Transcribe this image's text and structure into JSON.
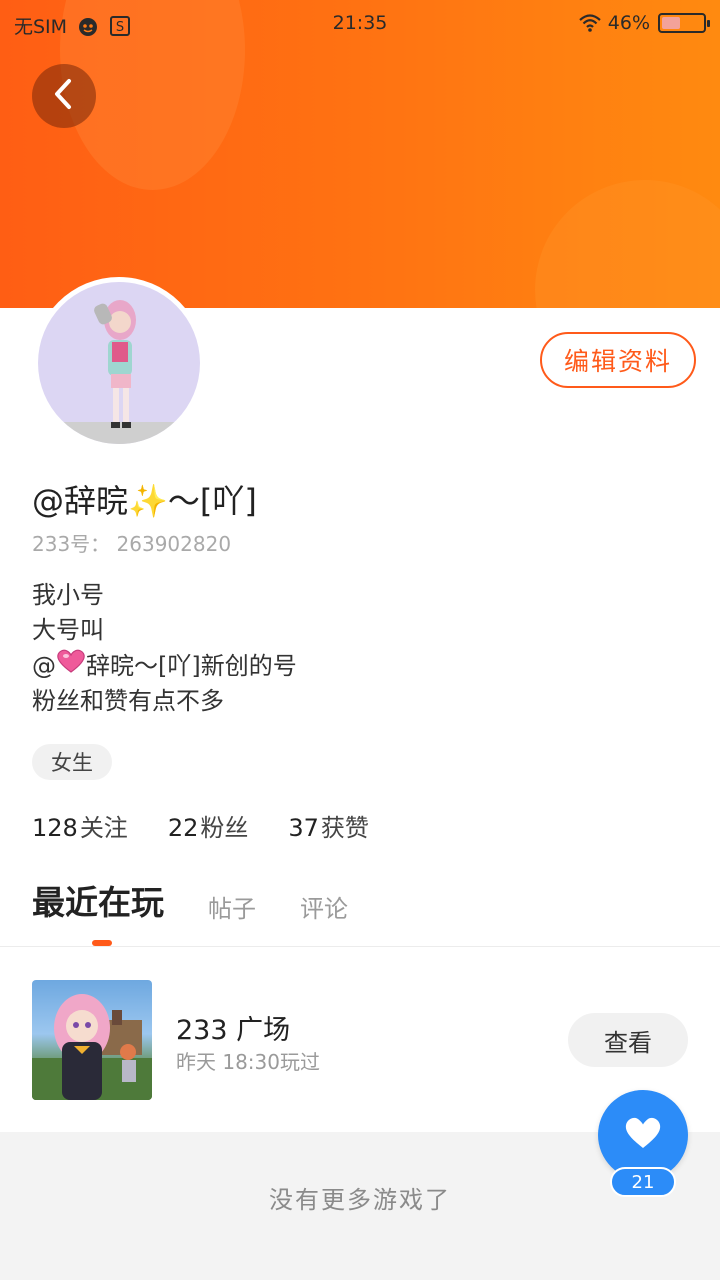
{
  "status_bar": {
    "carrier": "无SIM",
    "time": "21:35",
    "battery": "46%",
    "battery_level": 0.46
  },
  "profile": {
    "username": "@辞晥✨～[吖]",
    "user_id": "233号： 263902820",
    "edit_label": "编辑资料",
    "bio": {
      "line1": "我小号",
      "line2": "大号叫",
      "line3_prefix": "@",
      "line3_text": "辞晥～[吖]新创的号",
      "line4": "粉丝和赞有点不多"
    },
    "gender_tag": "女生",
    "stats": {
      "following_num": "128",
      "following_label": "关注",
      "fans_num": "22",
      "fans_label": "粉丝",
      "likes_num": "37",
      "likes_label": "获赞"
    }
  },
  "tabs": [
    {
      "label": "最近在玩",
      "active": true
    },
    {
      "label": "帖子",
      "active": false
    },
    {
      "label": "评论",
      "active": false
    }
  ],
  "games": [
    {
      "title": "233 广场",
      "played": "昨天 18:30玩过",
      "action": "查看"
    }
  ],
  "footer": {
    "no_more": "没有更多游戏了"
  },
  "like_fab": {
    "count": "21"
  },
  "colors": {
    "accent": "#ff5a1a",
    "header_start": "#ff5e14",
    "header_end": "#ff8a10",
    "fab_blue": "#2c8cf8"
  }
}
